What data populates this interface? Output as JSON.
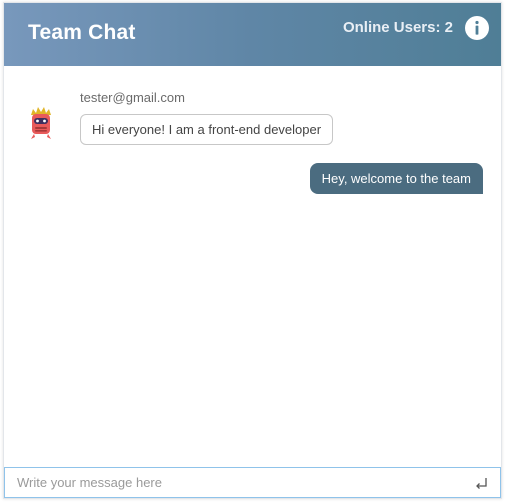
{
  "header": {
    "title": "Team Chat",
    "online_label": "Online Users: 2",
    "info_icon": "info-icon"
  },
  "messages": [
    {
      "direction": "incoming",
      "sender": "tester@gmail.com",
      "avatar_icon": "robot-monster-avatar-icon",
      "text": "Hi everyone! I am a front-end developer"
    },
    {
      "direction": "outgoing",
      "text": "Hey, welcome to the team"
    }
  ],
  "composer": {
    "placeholder": "Write your message here",
    "value": "",
    "send_icon": "enter-return-icon"
  },
  "colors": {
    "header_gradient_start": "#7898bc",
    "header_gradient_end": "#4f7e96",
    "outgoing_bubble": "#4b6c80",
    "input_border": "#8fc3ea"
  }
}
